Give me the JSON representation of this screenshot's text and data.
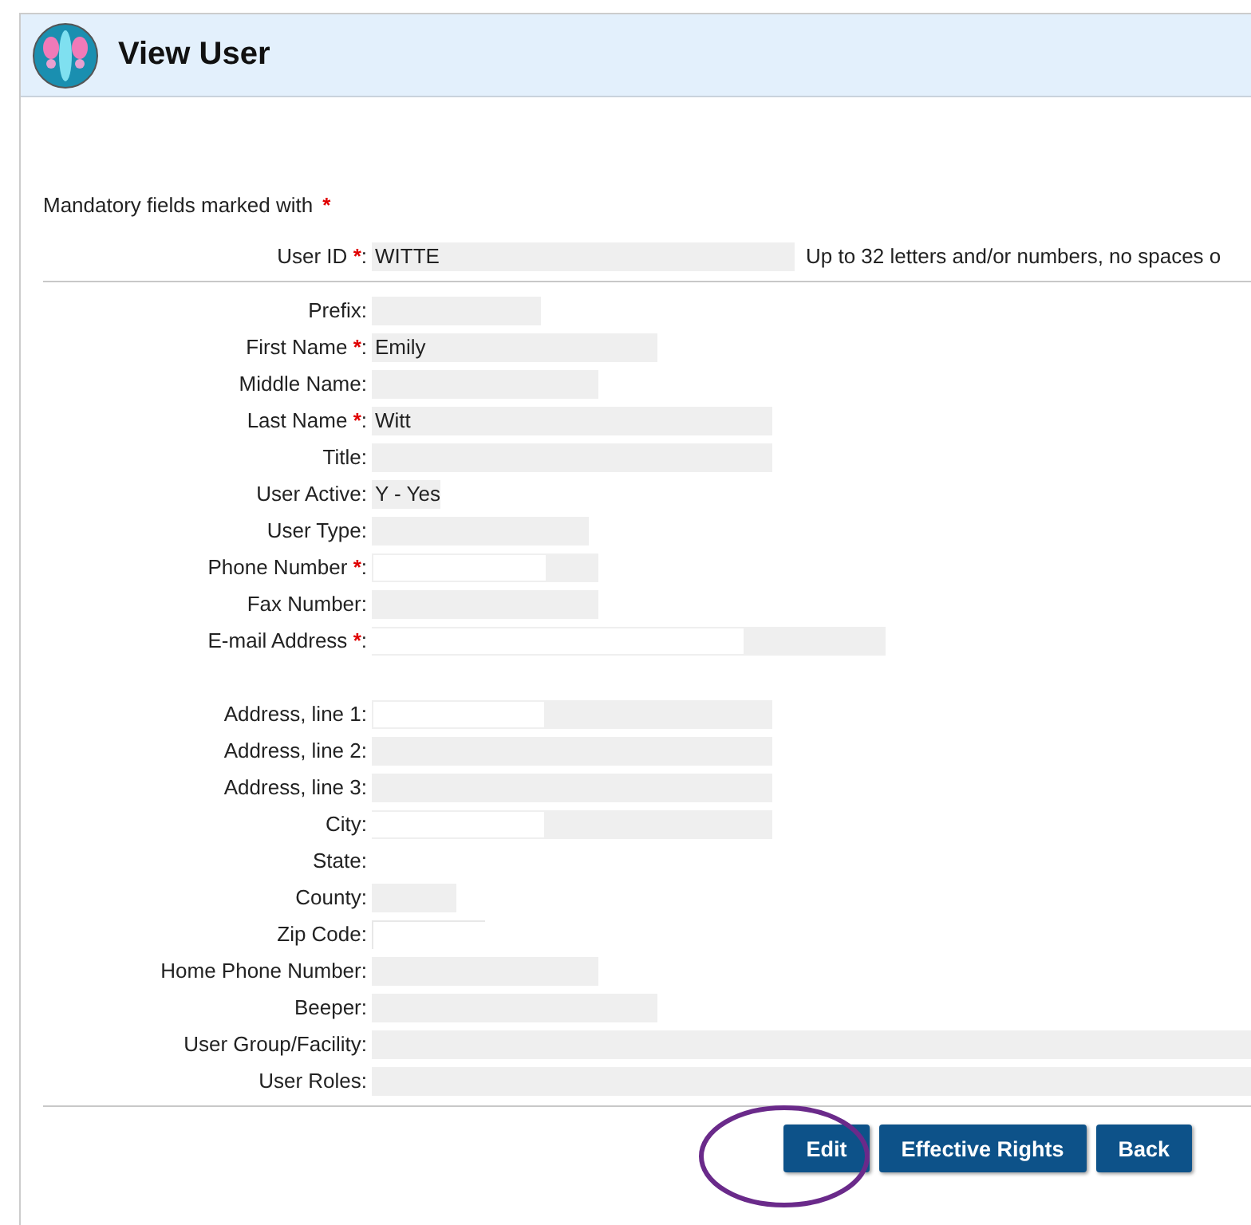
{
  "header": {
    "title": "View User"
  },
  "mandatory_note": "Mandatory fields marked with",
  "required_mark": "*",
  "separator": ":",
  "user_id": {
    "label": "User ID",
    "required": true,
    "value": "WITTE",
    "hint": "Up to 32 letters and/or numbers, no spaces o"
  },
  "personal_fields": [
    {
      "label": "Prefix",
      "required": false
    },
    {
      "label": "First Name",
      "required": true,
      "value": "Emily"
    },
    {
      "label": "Middle Name",
      "required": false
    },
    {
      "label": "Last Name",
      "required": true,
      "value": "Witt"
    },
    {
      "label": "Title",
      "required": false
    },
    {
      "label": "User Active",
      "required": false,
      "value": "Y - Yes"
    },
    {
      "label": "User Type",
      "required": false
    },
    {
      "label": "Phone Number",
      "required": true
    },
    {
      "label": "Fax Number",
      "required": false
    },
    {
      "label": "E-mail Address",
      "required": true
    }
  ],
  "address_fields": [
    {
      "label": "Address, line 1",
      "required": false
    },
    {
      "label": "Address, line 2",
      "required": false
    },
    {
      "label": "Address, line 3",
      "required": false
    },
    {
      "label": "City",
      "required": false
    },
    {
      "label": "State",
      "required": false
    },
    {
      "label": "County",
      "required": false
    },
    {
      "label": "Zip Code",
      "required": false
    },
    {
      "label": "Home Phone Number",
      "required": false
    },
    {
      "label": "Beeper",
      "required": false
    },
    {
      "label": "User Group/Facility",
      "required": false
    },
    {
      "label": "User Roles",
      "required": false
    }
  ],
  "buttons": [
    {
      "label": "Edit"
    },
    {
      "label": "Effective Rights"
    },
    {
      "label": "Back"
    }
  ]
}
